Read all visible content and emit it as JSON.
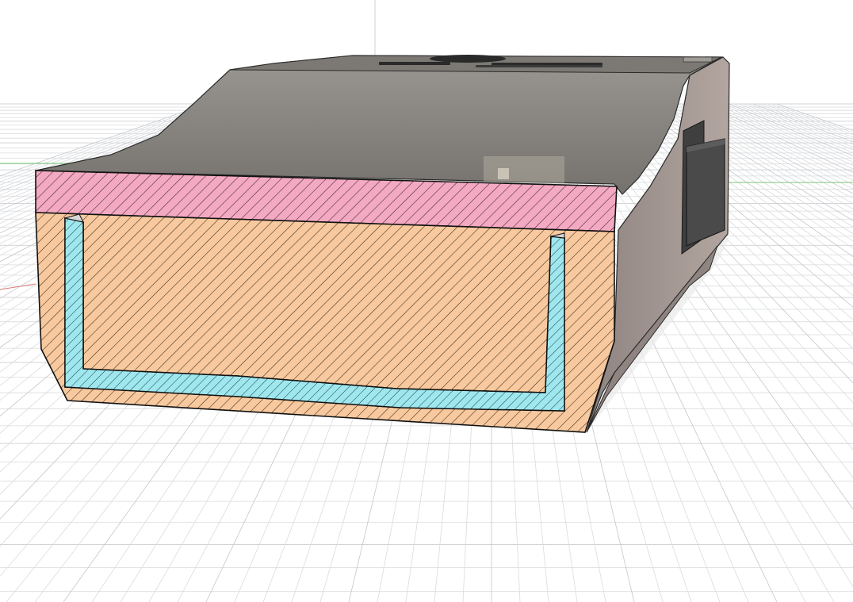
{
  "app": {
    "view": "section-analysis",
    "grid": true,
    "hatch_style": "diagonal"
  },
  "colors": {
    "background": "#ffffff",
    "grid_line": "#d9dbde",
    "grid_major": "#c4c7cb",
    "axis_green": "#7ac77a",
    "axis_red": "#e07a7a",
    "body_face": "#6f6c68",
    "body_top": "#8a8782",
    "body_side": "#a59993",
    "cavity_dark": "#3f3e3c",
    "cavity_floor": "#8f8d8a",
    "section_lid": "#f4a9c2",
    "section_outer": "#f8c99e",
    "section_inner": "#9fe7ee",
    "edge": "#1a1a1a"
  },
  "scene": {
    "objects": [
      {
        "id": "enclosure-body",
        "icon": "solid-body-icon"
      },
      {
        "id": "section-lid",
        "icon": "section-hatch-icon"
      },
      {
        "id": "section-outer-shell",
        "icon": "section-hatch-icon"
      },
      {
        "id": "section-inner-liner",
        "icon": "section-hatch-icon"
      },
      {
        "id": "top-embossed-logo",
        "icon": "emboss-icon"
      },
      {
        "id": "side-port",
        "icon": "port-icon"
      }
    ]
  }
}
